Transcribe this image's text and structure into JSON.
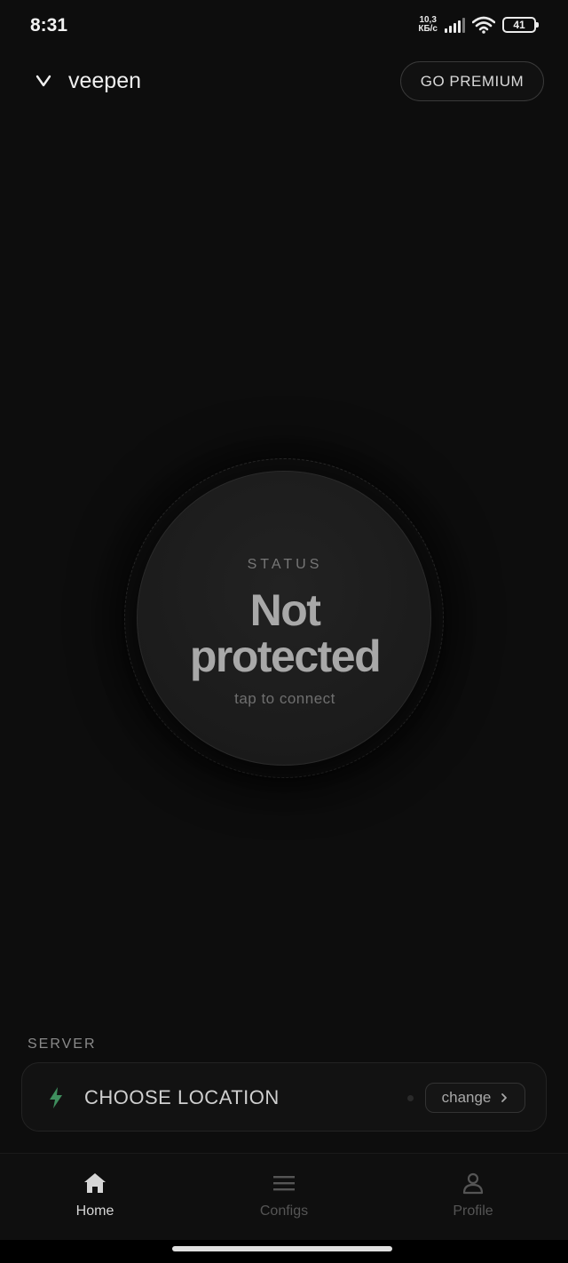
{
  "status_bar": {
    "time": "8:31",
    "net_speed_value": "10,3",
    "net_speed_unit": "КБ/с",
    "battery": "41"
  },
  "header": {
    "brand": "veepen",
    "premium_label": "GO PREMIUM"
  },
  "dial": {
    "label": "STATUS",
    "title_line1": "Not",
    "title_line2": "protected",
    "hint": "tap to connect"
  },
  "server": {
    "section_label": "SERVER",
    "location": "CHOOSE LOCATION",
    "change_label": "change",
    "bolt_color": "#3f8f5e"
  },
  "nav": {
    "items": [
      {
        "label": "Home",
        "icon": "home-icon"
      },
      {
        "label": "Configs",
        "icon": "menu-icon"
      },
      {
        "label": "Profile",
        "icon": "user-icon"
      }
    ],
    "active": "Home"
  }
}
